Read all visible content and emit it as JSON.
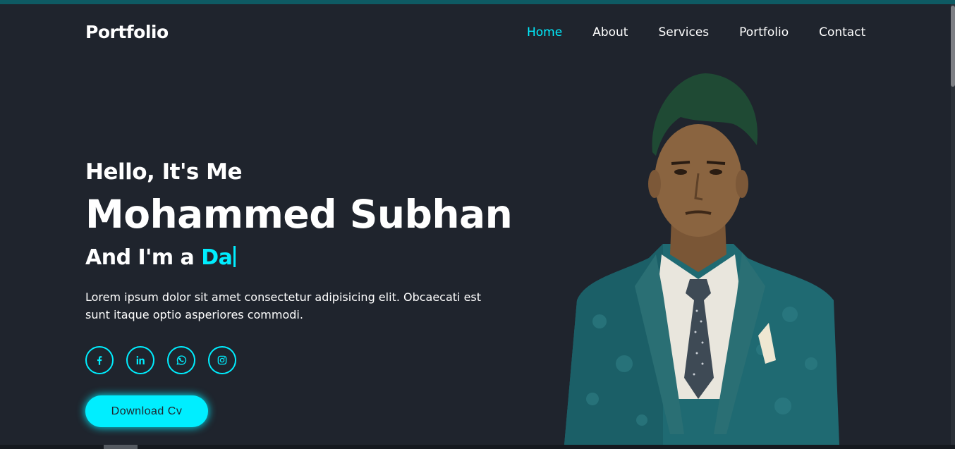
{
  "header": {
    "logo": "Portfolio",
    "nav": [
      {
        "label": "Home",
        "active": true
      },
      {
        "label": "About",
        "active": false
      },
      {
        "label": "Services",
        "active": false
      },
      {
        "label": "Portfolio",
        "active": false
      },
      {
        "label": "Contact",
        "active": false
      }
    ]
  },
  "hero": {
    "greeting": "Hello, It's Me",
    "name": "Mohammed Subhan",
    "role_prefix": "And I'm a ",
    "role_typed": "Da",
    "description": "Lorem ipsum dolor sit amet consectetur adipisicing elit. Obcaecati est sunt itaque optio asperiores commodi.",
    "socials": [
      {
        "icon": "facebook-icon"
      },
      {
        "icon": "linkedin-icon"
      },
      {
        "icon": "whatsapp-icon"
      },
      {
        "icon": "instagram-icon"
      }
    ],
    "cta_label": "Download Cv"
  },
  "colors": {
    "background": "#1f242d",
    "accent": "#00eeff",
    "text": "#ffffff"
  }
}
